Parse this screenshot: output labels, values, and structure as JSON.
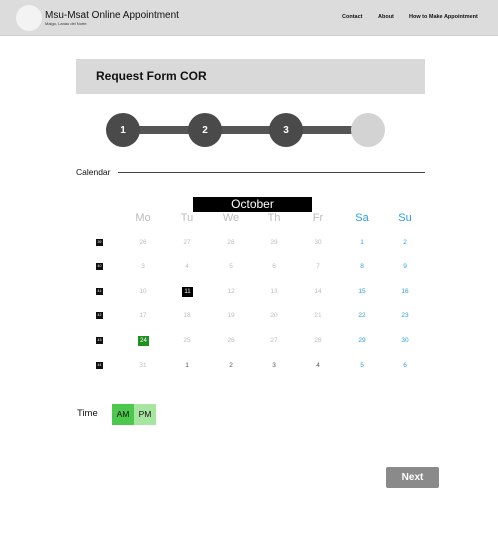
{
  "header": {
    "title": "Msu-Msat Online Appointment",
    "subtitle": "Maigo, Lanao del Norte",
    "nav": {
      "contact": "Contact",
      "about": "About",
      "how_to": "How to Make Appointment"
    }
  },
  "form": {
    "title": "Request Form COR"
  },
  "steps": [
    "1",
    "2",
    "3",
    ""
  ],
  "calendar": {
    "section_label": "Calendar",
    "month": "October",
    "weekdays": [
      "Mo",
      "Tu",
      "We",
      "Th",
      "Fr",
      "Sa",
      "Su"
    ],
    "week_numbers": [
      "39",
      "40",
      "41",
      "42",
      "43",
      "44"
    ],
    "weeks": [
      [
        "26",
        "27",
        "28",
        "29",
        "30",
        "1",
        "2"
      ],
      [
        "3",
        "4",
        "5",
        "6",
        "7",
        "8",
        "9"
      ],
      [
        "10",
        "11",
        "12",
        "13",
        "14",
        "15",
        "16"
      ],
      [
        "17",
        "18",
        "19",
        "20",
        "21",
        "22",
        "23"
      ],
      [
        "24",
        "25",
        "26",
        "27",
        "28",
        "29",
        "30"
      ],
      [
        "31",
        "1",
        "2",
        "3",
        "4",
        "5",
        "6"
      ]
    ],
    "selected_day": "11",
    "today": "24"
  },
  "time": {
    "label": "Time",
    "am": "AM",
    "pm": "PM"
  },
  "actions": {
    "next": "Next"
  },
  "colors": {
    "accent_blue": "#2b9fe0",
    "am_green": "#4cc84c",
    "pm_green": "#a7e6a0",
    "today_green": "#1f8f1f",
    "step_active": "#4a4a4a",
    "step_inactive": "#d3d3d3"
  }
}
